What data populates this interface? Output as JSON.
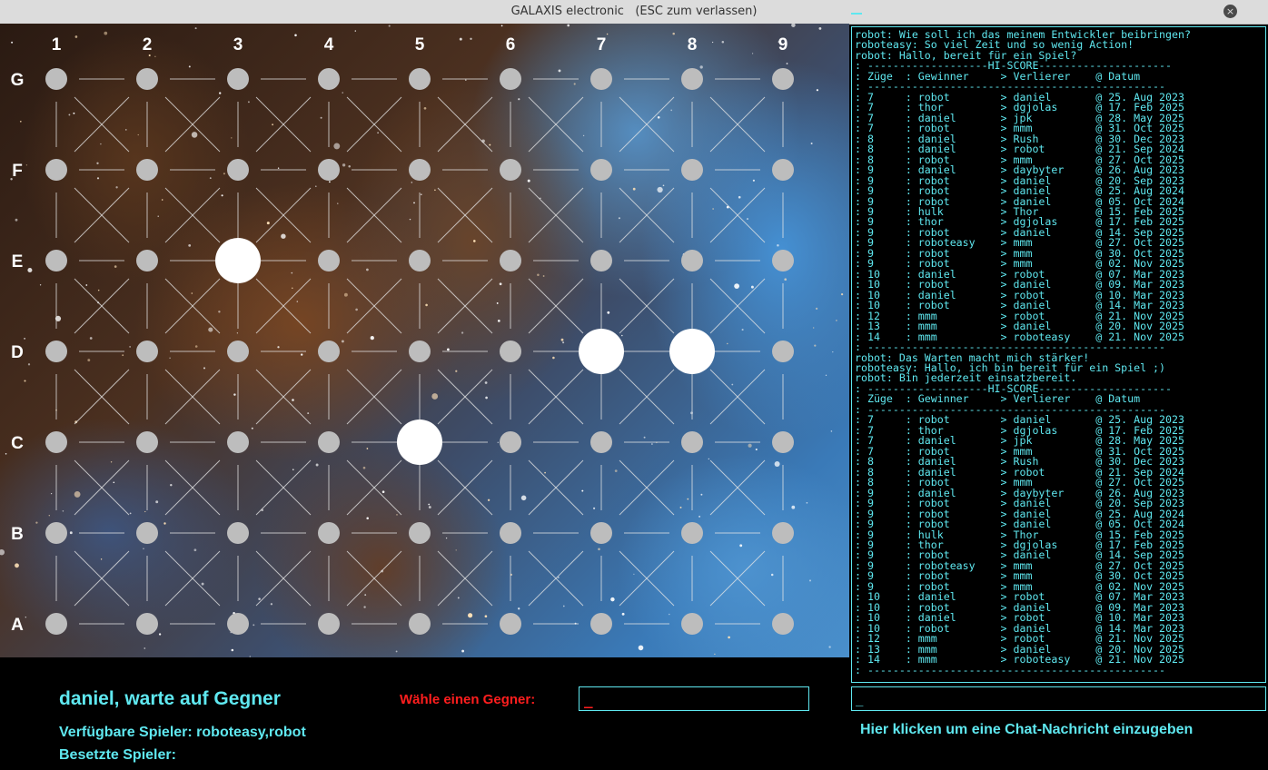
{
  "window": {
    "title": "GALAXIS electronic   (ESC zum verlassen)",
    "close_icon": "×"
  },
  "board": {
    "columns": [
      "1",
      "2",
      "3",
      "4",
      "5",
      "6",
      "7",
      "8",
      "9"
    ],
    "rows": [
      "G",
      "F",
      "E",
      "D",
      "C",
      "B",
      "A"
    ],
    "placed_markers": [
      "E3",
      "D7",
      "D8",
      "C5"
    ],
    "dot_color": "#bdbdbd",
    "marker_color": "#ffffff"
  },
  "status": {
    "message": "daniel, warte auf Gegner",
    "available_players": "Verfügbare Spieler: roboteasy,robot",
    "busy_players": "Besetzte Spieler:"
  },
  "opponent": {
    "label": "Wähle einen Gegner:",
    "value": "_"
  },
  "chat": {
    "lines": [
      "robot: Wie soll ich das meinem Entwickler beibringen?",
      "roboteasy: So viel Zeit und so wenig Action!",
      "robot: Hallo, bereit für ein Spiel?",
      ": -------------------HI-SCORE---------------------",
      ": Züge  : Gewinner     > Verlierer    @ Datum",
      ": -----------------------------------------------",
      ": 7     : robot        > daniel       @ 25. Aug 2023",
      ": 7     : thor         > dgjolas      @ 17. Feb 2025",
      ": 7     : daniel       > jpk          @ 28. May 2025",
      ": 7     : robot        > mmm          @ 31. Oct 2025",
      ": 8     : daniel       > Rush         @ 30. Dec 2023",
      ": 8     : daniel       > robot        @ 21. Sep 2024",
      ": 8     : robot        > mmm          @ 27. Oct 2025",
      ": 9     : daniel       > daybyter     @ 26. Aug 2023",
      ": 9     : robot        > daniel       @ 20. Sep 2023",
      ": 9     : robot        > daniel       @ 25. Aug 2024",
      ": 9     : robot        > daniel       @ 05. Oct 2024",
      ": 9     : hulk         > Thor         @ 15. Feb 2025",
      ": 9     : thor         > dgjolas      @ 17. Feb 2025",
      ": 9     : robot        > daniel       @ 14. Sep 2025",
      ": 9     : roboteasy    > mmm          @ 27. Oct 2025",
      ": 9     : robot        > mmm          @ 30. Oct 2025",
      ": 9     : robot        > mmm          @ 02. Nov 2025",
      ": 10    : daniel       > robot        @ 07. Mar 2023",
      ": 10    : robot        > daniel       @ 09. Mar 2023",
      ": 10    : daniel       > robot        @ 10. Mar 2023",
      ": 10    : robot        > daniel       @ 14. Mar 2023",
      ": 12    : mmm          > robot        @ 21. Nov 2025",
      ": 13    : mmm          > daniel       @ 20. Nov 2025",
      ": 14    : mmm          > roboteasy    @ 21. Nov 2025",
      ": -----------------------------------------------",
      "robot: Das Warten macht mich stärker!",
      "roboteasy: Hallo, ich bin bereit für ein Spiel ;)",
      "robot: Bin jederzeit einsatzbereit.",
      ": -------------------HI-SCORE---------------------",
      ": Züge  : Gewinner     > Verlierer    @ Datum",
      ": -----------------------------------------------",
      ": 7     : robot        > daniel       @ 25. Aug 2023",
      ": 7     : thor         > dgjolas      @ 17. Feb 2025",
      ": 7     : daniel       > jpk          @ 28. May 2025",
      ": 7     : robot        > mmm          @ 31. Oct 2025",
      ": 8     : daniel       > Rush         @ 30. Dec 2023",
      ": 8     : daniel       > robot        @ 21. Sep 2024",
      ": 8     : robot        > mmm          @ 27. Oct 2025",
      ": 9     : daniel       > daybyter     @ 26. Aug 2023",
      ": 9     : robot        > daniel       @ 20. Sep 2023",
      ": 9     : robot        > daniel       @ 25. Aug 2024",
      ": 9     : robot        > daniel       @ 05. Oct 2024",
      ": 9     : hulk         > Thor         @ 15. Feb 2025",
      ": 9     : thor         > dgjolas      @ 17. Feb 2025",
      ": 9     : robot        > daniel       @ 14. Sep 2025",
      ": 9     : roboteasy    > mmm          @ 27. Oct 2025",
      ": 9     : robot        > mmm          @ 30. Oct 2025",
      ": 9     : robot        > mmm          @ 02. Nov 2025",
      ": 10    : daniel       > robot        @ 07. Mar 2023",
      ": 10    : robot        > daniel       @ 09. Mar 2023",
      ": 10    : daniel       > robot        @ 10. Mar 2023",
      ": 10    : robot        > daniel       @ 14. Mar 2023",
      ": 12    : mmm          > robot        @ 21. Nov 2025",
      ": 13    : mmm          > daniel       @ 20. Nov 2025",
      ": 14    : mmm          > roboteasy    @ 21. Nov 2025",
      ": -----------------------------------------------"
    ],
    "input_value": "_",
    "hint": "Hier klicken um eine Chat-Nachricht einzugeben"
  }
}
